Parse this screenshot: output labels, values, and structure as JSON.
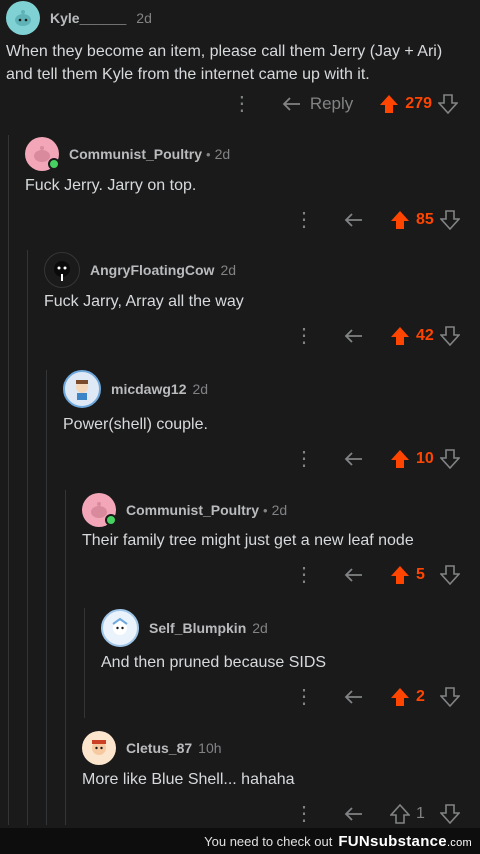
{
  "comments": [
    {
      "username": "Kyle______",
      "age": "2d",
      "body": "When they become an item, please call them Jerry (Jay + Ari)\nand tell them Kyle from the internet came up with it.",
      "reply_label": "Reply",
      "score": "279",
      "upvoted": true,
      "avatar_color": "#7fd1d4"
    },
    {
      "username": "Communist_Poultry",
      "age": "2d",
      "body": "Fuck Jerry. Jarry on top.",
      "score": "85",
      "upvoted": true,
      "avatar_color": "#f2a6b8"
    },
    {
      "username": "AngryFloatingCow",
      "age": "2d",
      "body": "Fuck Jarry, Array all the way",
      "score": "42",
      "upvoted": true,
      "avatar_color": "#1a1a1b"
    },
    {
      "username": "micdawg12",
      "age": "2d",
      "body": "Power(shell) couple.",
      "score": "10",
      "upvoted": true,
      "avatar_color": "#6fa8dc"
    },
    {
      "username": "Communist_Poultry",
      "age": "2d",
      "body": "Their family tree might just get a new leaf node",
      "score": "5",
      "upvoted": true,
      "avatar_color": "#f2a6b8"
    },
    {
      "username": "Self_Blumpkin",
      "age": "2d",
      "body": "And then pruned because SIDS",
      "score": "2",
      "upvoted": true,
      "avatar_color": "#9fc5e8"
    },
    {
      "username": "Cletus_87",
      "age": "10h",
      "body": "More like Blue Shell... hahaha",
      "score": "1",
      "upvoted": false,
      "avatar_color": "#e69138"
    }
  ],
  "footer": {
    "message": "You need to check out",
    "brand": "FUNsubstance",
    "brand_suffix": ".com"
  },
  "colors": {
    "upvote": "#ff4500",
    "background": "#1a1a1b",
    "muted": "#818384"
  }
}
